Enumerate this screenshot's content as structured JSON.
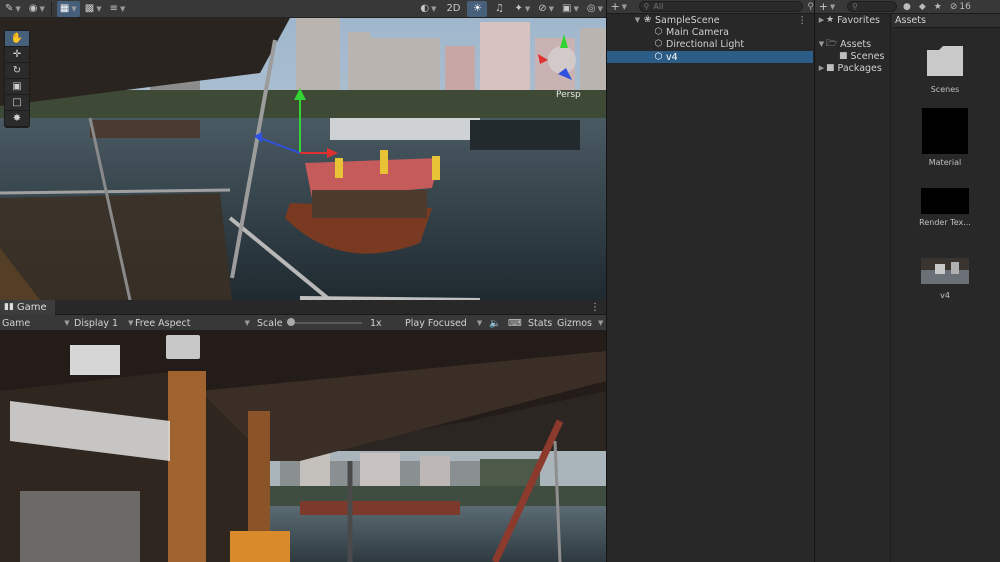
{
  "scene_toolbar": {
    "mode_2d": "2D",
    "icons": [
      "brush-icon",
      "globe-icon",
      "grid-icon",
      "snap-icon",
      "increment-icon",
      "shading-icon",
      "lighting-icon",
      "audio-icon",
      "effects-icon",
      "hidden-icon",
      "camera-icon",
      "gizmo-icon"
    ]
  },
  "scene_view": {
    "camera_label": "Persp"
  },
  "game_view": {
    "tab_label": "Game",
    "mode_dropdown": "Game",
    "display_dropdown": "Display 1",
    "aspect_dropdown": "Free Aspect",
    "scale_label": "Scale",
    "scale_value": "1x",
    "scale_slider_fraction": 0.0,
    "play_mode_dropdown": "Play Focused",
    "stats_label": "Stats",
    "gizmos_label": "Gizmos"
  },
  "hierarchy": {
    "search_placeholder": "All",
    "scene_name": "SampleScene",
    "items": [
      {
        "label": "Main Camera",
        "icon": "cube-icon"
      },
      {
        "label": "Directional Light",
        "icon": "cube-icon"
      },
      {
        "label": "v4",
        "icon": "cube-icon",
        "selected": true
      }
    ]
  },
  "project": {
    "search_badge": "16",
    "favorites_label": "Favorites",
    "tree": {
      "assets": "Assets",
      "scenes": "Scenes",
      "packages": "Packages"
    },
    "grid_header": "Assets",
    "assets": [
      {
        "label": "Scenes",
        "kind": "folder"
      },
      {
        "label": "Material",
        "kind": "material"
      },
      {
        "label": "Render Tex...",
        "kind": "render-texture"
      },
      {
        "label": "v4",
        "kind": "video"
      }
    ]
  }
}
